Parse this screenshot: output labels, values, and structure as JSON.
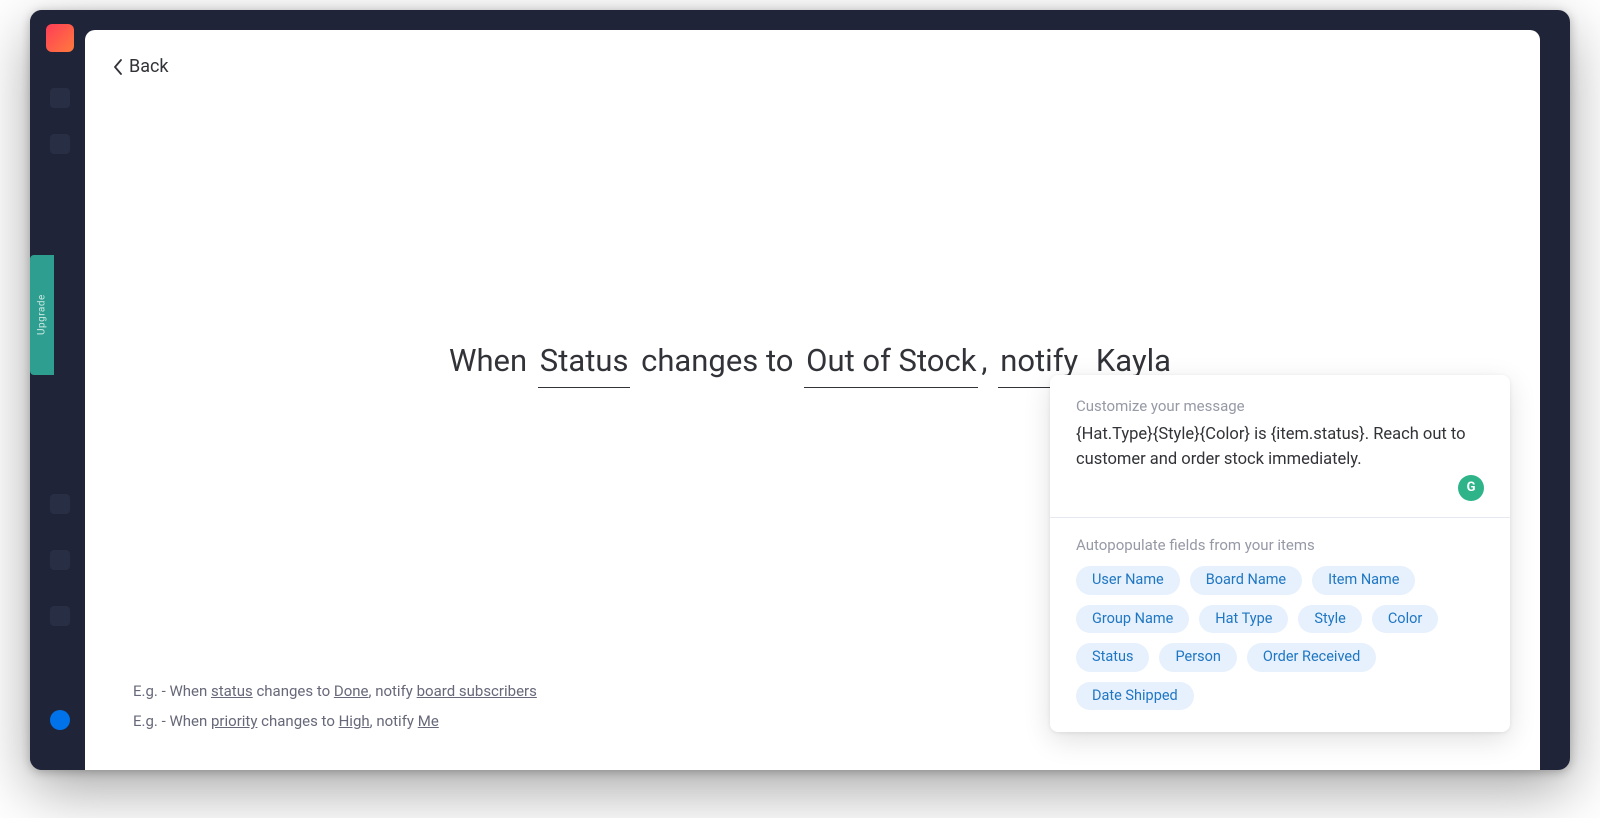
{
  "leftnav": {
    "upgrade_label": "Upgrade"
  },
  "back": {
    "label": "Back"
  },
  "sentence": {
    "prefix1": "When ",
    "token_column": "Status",
    "mid1": " changes to ",
    "token_value": "Out of Stock",
    "comma": ", ",
    "token_action": "notify",
    "space": " ",
    "token_person": "Kayla"
  },
  "examples": [
    {
      "prefix": "E.g. - When ",
      "a": "status",
      "mid1": " changes to ",
      "b": "Done",
      "mid2": ", notify ",
      "c": "board subscribers"
    },
    {
      "prefix": "E.g. - When ",
      "a": "priority",
      "mid1": " changes to ",
      "b": "High",
      "mid2": ", notify ",
      "c": "Me"
    }
  ],
  "popover": {
    "customize_label": "Customize your message",
    "message": "{Hat.Type}{Style}{Color} is {item.status}. Reach out to customer and order stock immediately.",
    "autopopulate_label": "Autopopulate fields from your items",
    "grammarly_badge": "G",
    "pills": [
      "User Name",
      "Board Name",
      "Item Name",
      "Group Name",
      "Hat Type",
      "Style",
      "Color",
      "Status",
      "Person",
      "Order Received",
      "Date Shipped"
    ]
  }
}
